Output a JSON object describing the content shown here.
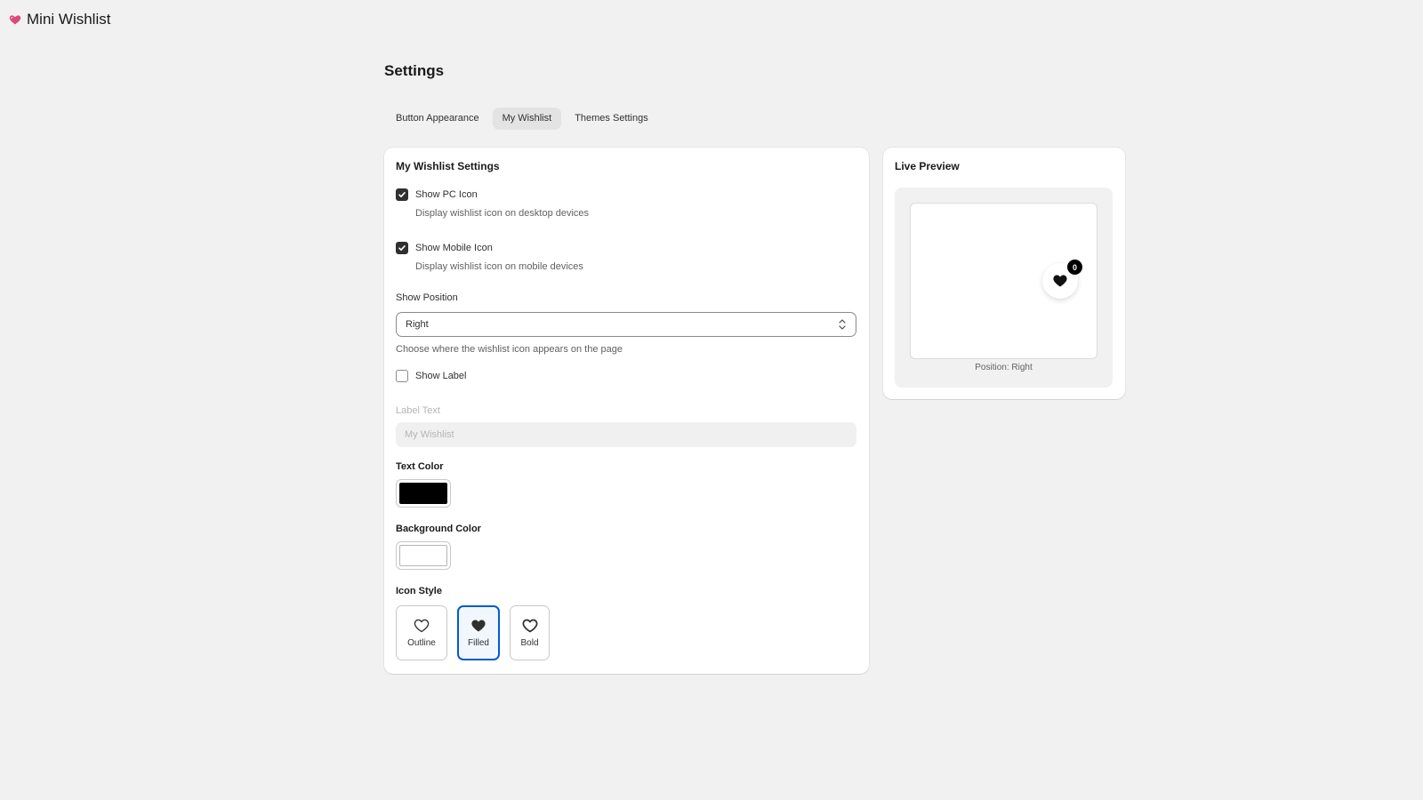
{
  "app": {
    "title": "Mini Wishlist",
    "logo_icon": "heart-icon"
  },
  "page": {
    "title": "Settings"
  },
  "tabs": [
    {
      "label": "Button Appearance",
      "active": false
    },
    {
      "label": "My Wishlist",
      "active": true
    },
    {
      "label": "Themes Settings",
      "active": false
    }
  ],
  "settings": {
    "title": "My Wishlist Settings",
    "show_pc_icon": {
      "label": "Show PC Icon",
      "checked": true,
      "help": "Display wishlist icon on desktop devices"
    },
    "show_mobile_icon": {
      "label": "Show Mobile Icon",
      "checked": true,
      "help": "Display wishlist icon on mobile devices"
    },
    "show_position": {
      "label": "Show Position",
      "value": "Right",
      "help": "Choose where the wishlist icon appears on the page"
    },
    "show_label": {
      "label": "Show Label",
      "checked": false
    },
    "label_text": {
      "label": "Label Text",
      "placeholder": "My Wishlist"
    },
    "text_color": {
      "label": "Text Color",
      "value": "#000000"
    },
    "background_color": {
      "label": "Background Color",
      "value": "#ffffff"
    },
    "icon_style": {
      "label": "Icon Style",
      "options": [
        {
          "label": "Outline",
          "icon": "heart-outline-icon",
          "selected": false
        },
        {
          "label": "Filled",
          "icon": "heart-filled-icon",
          "selected": true
        },
        {
          "label": "Bold",
          "icon": "heart-bold-icon",
          "selected": false
        }
      ]
    }
  },
  "preview": {
    "title": "Live Preview",
    "badge_count": "0",
    "position_caption": "Position: Right"
  },
  "colors": {
    "accent": "#005bd3",
    "logo": "#e0467c"
  }
}
